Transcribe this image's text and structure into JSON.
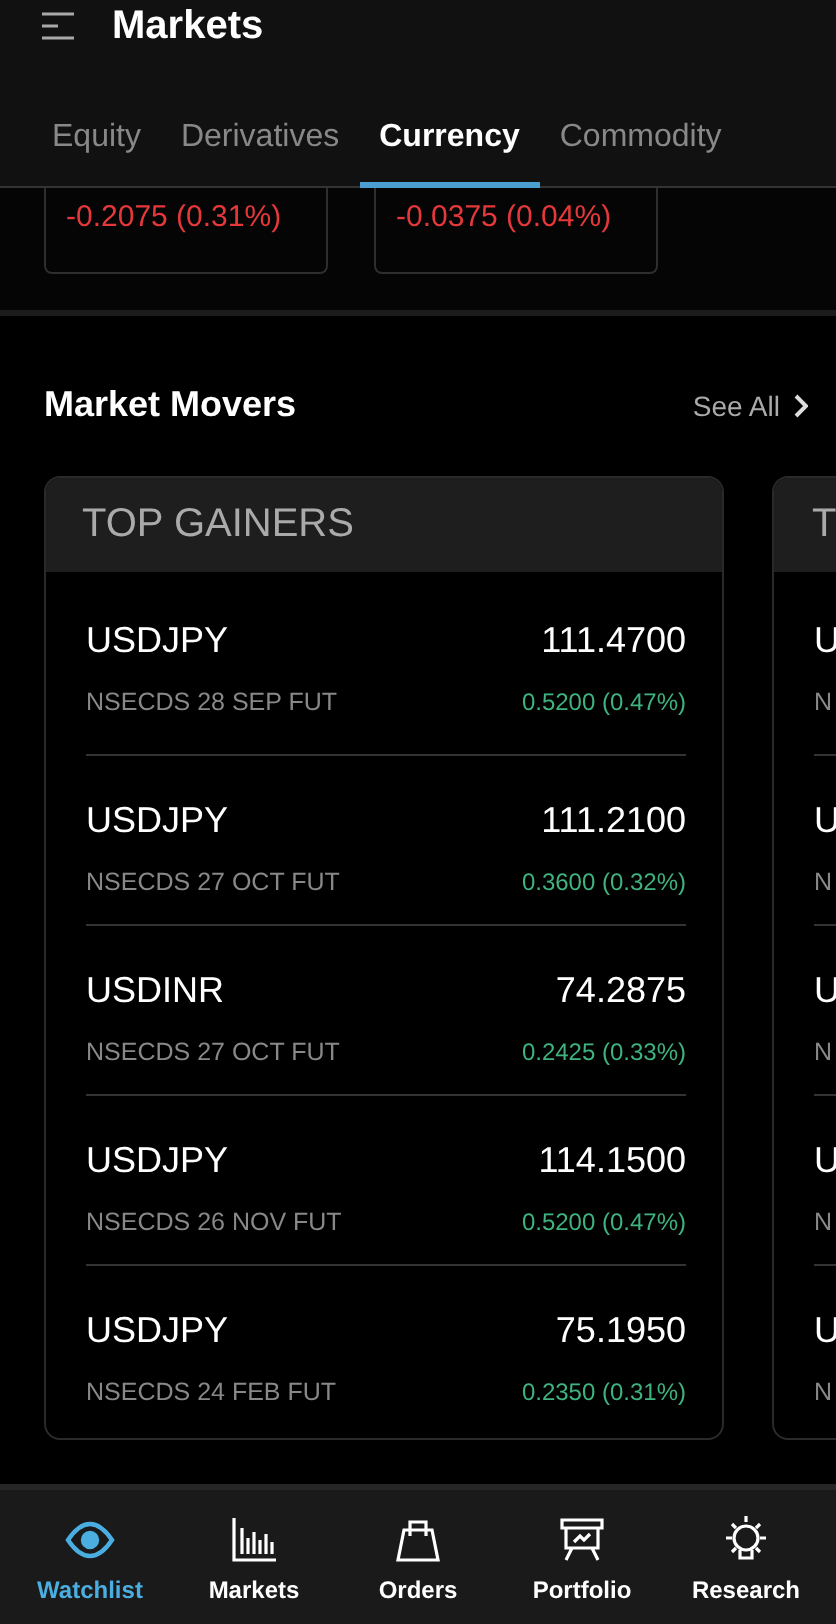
{
  "header": {
    "title": "Markets"
  },
  "tabs": [
    {
      "label": "Equity",
      "selected": false
    },
    {
      "label": "Derivatives",
      "selected": false
    },
    {
      "label": "Currency",
      "selected": true
    },
    {
      "label": "Commodity",
      "selected": false
    }
  ],
  "index_cards": [
    {
      "change": "-0.2075 (0.31%)",
      "color": "#e5383b"
    },
    {
      "change": "-0.0375 (0.04%)",
      "color": "#e5383b"
    }
  ],
  "market_movers": {
    "title": "Market Movers",
    "see_all": "See All",
    "cards": [
      {
        "title": "TOP GAINERS",
        "rows": [
          {
            "symbol": "USDJPY",
            "contract": "NSECDS 28 SEP FUT",
            "price": "111.4700",
            "change": "0.5200 (0.47%)",
            "color": "#3fb37f"
          },
          {
            "symbol": "USDJPY",
            "contract": "NSECDS 27 OCT FUT",
            "price": "111.2100",
            "change": "0.3600 (0.32%)",
            "color": "#3fb37f"
          },
          {
            "symbol": "USDINR",
            "contract": "NSECDS 27 OCT FUT",
            "price": "74.2875",
            "change": "0.2425 (0.33%)",
            "color": "#3fb37f"
          },
          {
            "symbol": "USDJPY",
            "contract": "NSECDS 26 NOV FUT",
            "price": "114.1500",
            "change": "0.5200 (0.47%)",
            "color": "#3fb37f"
          },
          {
            "symbol": "USDJPY",
            "contract": "NSECDS 24 FEB FUT",
            "price": "75.1950",
            "change": "0.2350 (0.31%)",
            "color": "#3fb37f"
          }
        ]
      },
      {
        "title": "T",
        "rows": [
          {
            "symbol": "U",
            "contract": "N"
          },
          {
            "symbol": "U",
            "contract": "N"
          },
          {
            "symbol": "U",
            "contract": "N"
          },
          {
            "symbol": "U",
            "contract": "N"
          },
          {
            "symbol": "U",
            "contract": "N"
          }
        ]
      }
    ]
  },
  "bottom_nav": [
    {
      "label": "Watchlist",
      "kind": "eye",
      "selected": true
    },
    {
      "label": "Markets",
      "kind": "bars",
      "selected": false
    },
    {
      "label": "Orders",
      "kind": "bag",
      "selected": false
    },
    {
      "label": "Portfolio",
      "kind": "board",
      "selected": false
    },
    {
      "label": "Research",
      "kind": "bulb",
      "selected": false
    }
  ]
}
